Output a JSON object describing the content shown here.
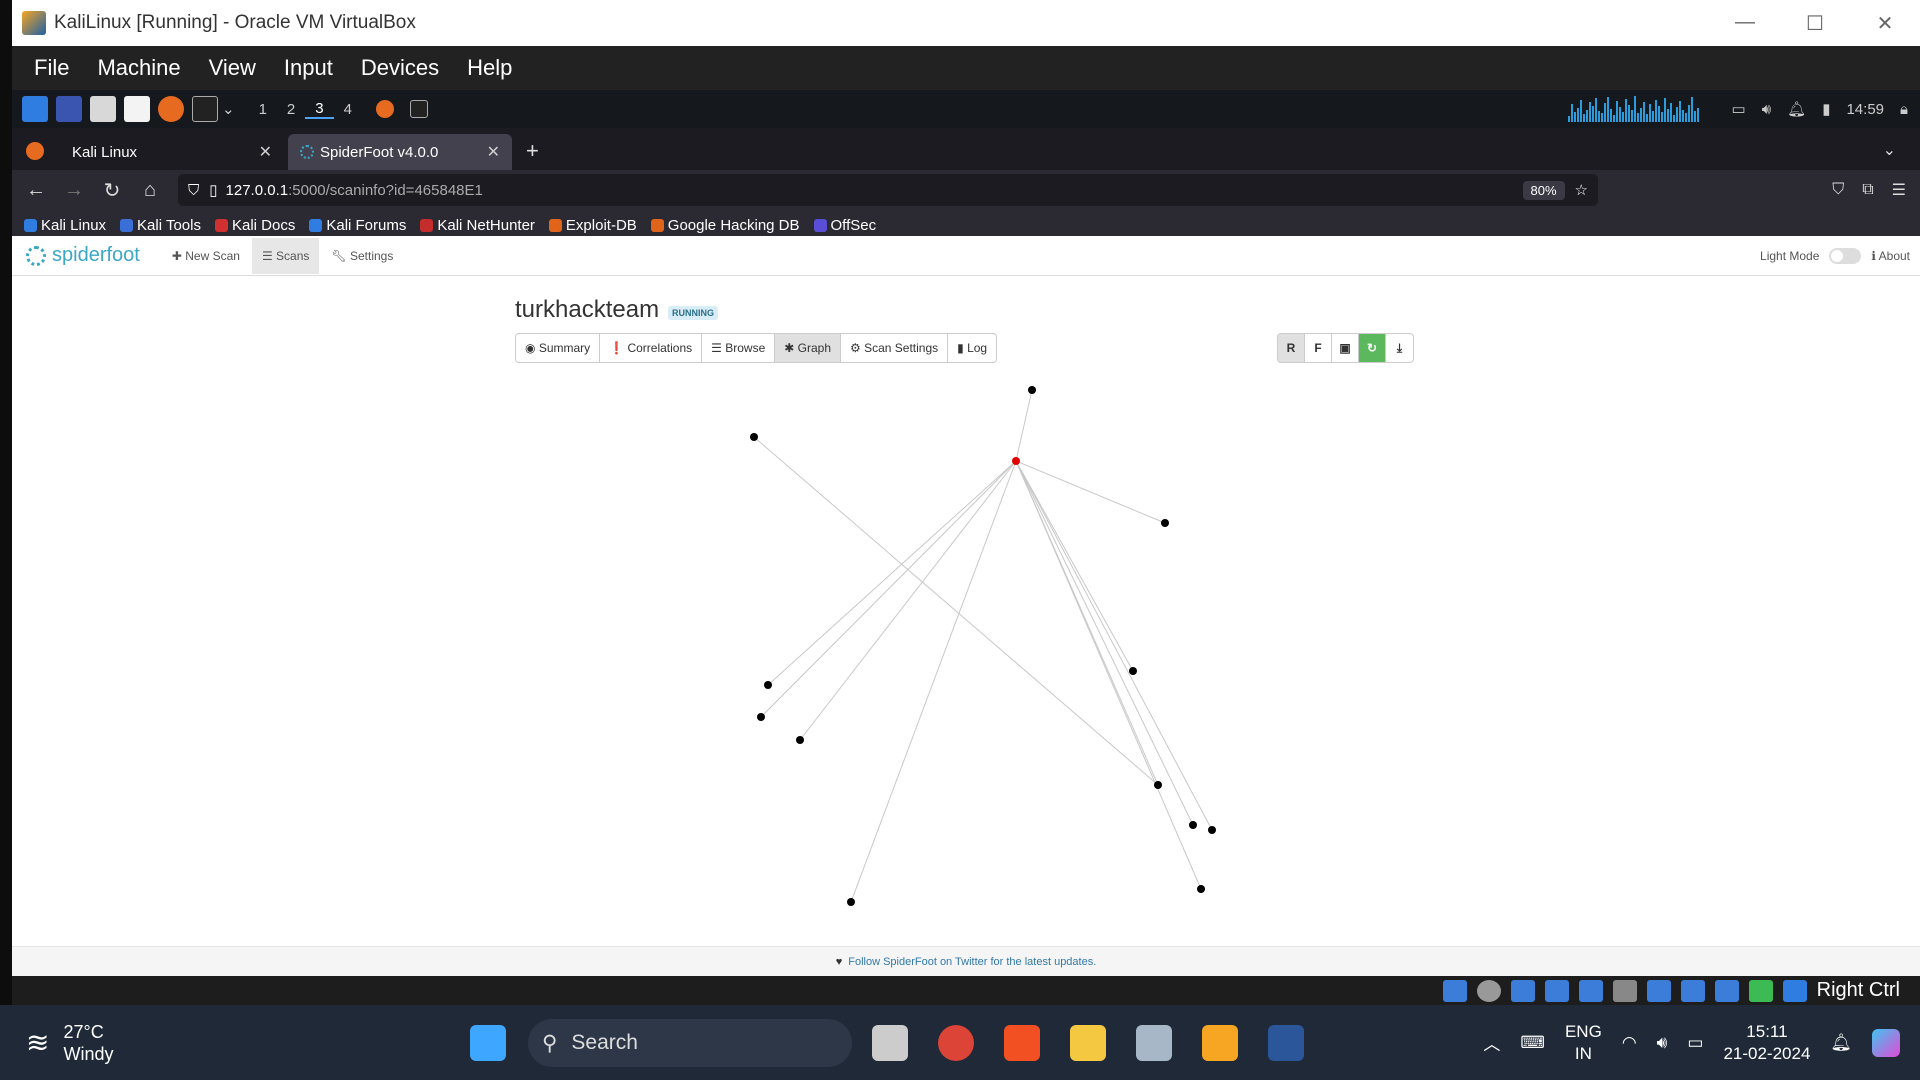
{
  "vbox": {
    "title": "KaliLinux [Running] - Oracle VM VirtualBox",
    "menu": [
      "File",
      "Machine",
      "View",
      "Input",
      "Devices",
      "Help"
    ],
    "host_key": "Right Ctrl"
  },
  "kali_panel": {
    "workspaces": [
      "1",
      "2",
      "3",
      "4"
    ],
    "active_workspace": "3",
    "time": "14:59"
  },
  "browser": {
    "tabs": [
      {
        "label": "Kali Linux",
        "active": false
      },
      {
        "label": "SpiderFoot v4.0.0",
        "active": true
      }
    ],
    "url_host": "127.0.0.1",
    "url_rest": ":5000/scaninfo?id=465848E1",
    "zoom": "80%",
    "bookmarks": [
      "Kali Linux",
      "Kali Tools",
      "Kali Docs",
      "Kali Forums",
      "Kali NetHunter",
      "Exploit-DB",
      "Google Hacking DB",
      "OffSec"
    ]
  },
  "spiderfoot": {
    "logo_text": "spiderfoot",
    "nav": {
      "new_scan": "New Scan",
      "scans": "Scans",
      "settings": "Settings"
    },
    "light_mode": "Light Mode",
    "about": "About",
    "scan_name": "turkhackteam",
    "status": "RUNNING",
    "tabs": [
      "Summary",
      "Correlations",
      "Browse",
      "Graph",
      "Scan Settings",
      "Log"
    ],
    "active_tab": "Graph",
    "graph_controls": [
      "R",
      "F"
    ],
    "footer": "Follow SpiderFoot on Twitter for the latest updates.",
    "graph": {
      "root_color": "#e00000",
      "node_color": "#000000",
      "edge_color": "#c8c8c8"
    }
  },
  "taskbar": {
    "temp": "27°C",
    "weather": "Windy",
    "search": "Search",
    "lang1": "ENG",
    "lang2": "IN",
    "time": "15:11",
    "date": "21-02-2024"
  }
}
